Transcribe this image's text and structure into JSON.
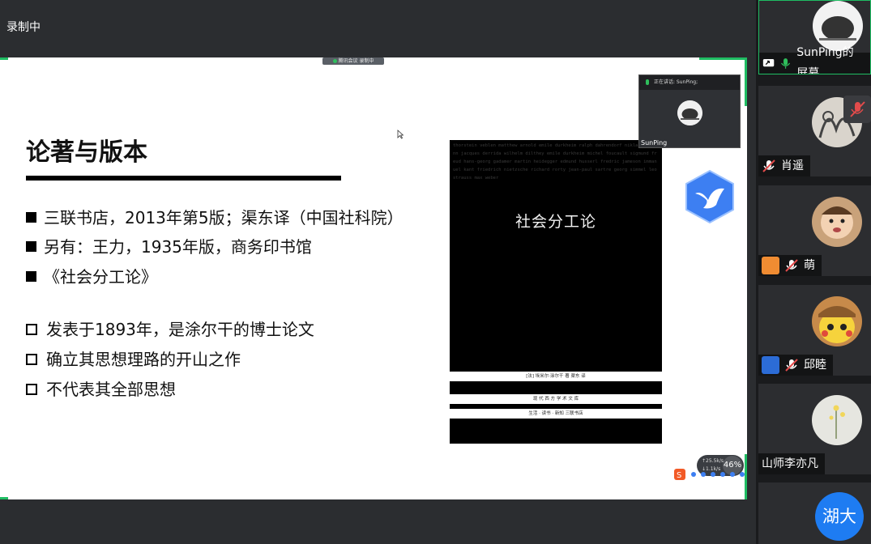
{
  "window": {
    "recording_label": "录制中"
  },
  "share_tag": {
    "text": "腾讯会议   录制中"
  },
  "slide": {
    "title": "论著与版本",
    "bullets_filled": [
      "三联书店，2013年第5版；渠东译（中国社科院）",
      "另有：王力，1935年版，商务印书馆",
      "《社会分工论》"
    ],
    "bullets_hollow": [
      "发表于1893年，是涂尔干的博士论文",
      "确立其思想理路的开山之作",
      "不代表其全部思想"
    ],
    "book": {
      "title": "社会分工论",
      "names_text": "thorstein veblen matthew arnold emile durkheim ralph dahrendorf niklas luhmann jacques derrida wilhelm dilthey emile durkheim michel foucault sigmund freud hans-georg gadamer martin heidegger edmund husserl fredric jameson immanuel kant friedrich nietzsche richard rorty jean-paul sartre georg simmel leo strauss max weber",
      "author_band": "[法] 埃米尔·涂尔干 著  渠东 译",
      "series_band": "现 代 西 方 学 术 文 库",
      "publisher_band": "生活 · 读书 · 新知 三联书店"
    }
  },
  "presenter": {
    "header": "正在讲话: SunPing;",
    "name": "SunPing"
  },
  "net_speed": {
    "up": "↑25.5k/s",
    "down": "↓1.1k/s",
    "percent": "46%"
  },
  "participants": [
    {
      "name": "SunPing的屏幕",
      "muted": false
    },
    {
      "name": "肖遥",
      "muted": true
    },
    {
      "name": "萌",
      "muted": true
    },
    {
      "name": "邱睦",
      "muted": true
    },
    {
      "name": "山师李亦凡",
      "muted": false
    },
    {
      "name": "湖大",
      "muted": false
    }
  ],
  "colors": {
    "accent_green": "#1fbd63",
    "sidebar_bg": "#1a1b1d",
    "slide_bg": "#ffffff",
    "tencent_blue": "#3d7ff2"
  }
}
